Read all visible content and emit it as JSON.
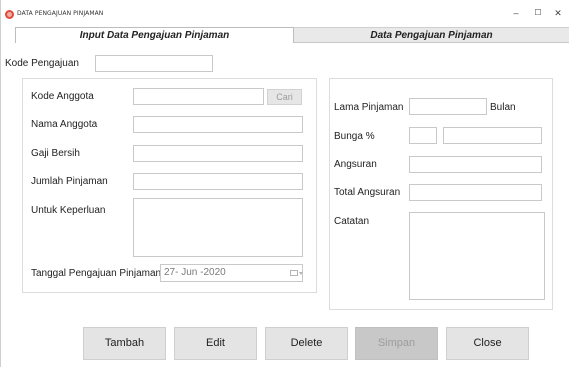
{
  "window": {
    "title": "DATA PENGAJUAN PINJAMAN",
    "minimize": "–",
    "maximize": "☐",
    "close": "✕"
  },
  "tabs": [
    {
      "label": "Input Data Pengajuan Pinjaman",
      "active": true
    },
    {
      "label": "Data Pengajuan Pinjaman",
      "active": false
    }
  ],
  "form": {
    "kode_pengajuan": {
      "label": "Kode Pengajuan",
      "value": ""
    },
    "kode_anggota": {
      "label": "Kode Anggota",
      "value": ""
    },
    "cari_button": "Cari",
    "nama_anggota": {
      "label": "Nama Anggota",
      "value": ""
    },
    "gaji_bersih": {
      "label": "Gaji Bersih",
      "value": ""
    },
    "jumlah_pinjaman": {
      "label": "Jumlah Pinjaman",
      "value": ""
    },
    "untuk_keperluan": {
      "label": "Untuk Keperluan",
      "value": ""
    },
    "tanggal_pengajuan": {
      "label": "Tanggal Pengajuan Pinjaman",
      "value": "27- Jun -2020"
    },
    "lama_pinjaman": {
      "label": "Lama Pinjaman",
      "value": "",
      "unit": "Bulan"
    },
    "bunga": {
      "label": "Bunga %",
      "value": "",
      "value2": ""
    },
    "angsuran": {
      "label": "Angsuran",
      "value": ""
    },
    "total_angsuran": {
      "label": "Total Angsuran",
      "value": ""
    },
    "catatan": {
      "label": "Catatan",
      "value": ""
    }
  },
  "buttons": {
    "tambah": "Tambah",
    "edit": "Edit",
    "delete": "Delete",
    "simpan": "Simpan",
    "close": "Close"
  },
  "colors": {
    "app_icon": "#e04b3a",
    "disabled_button": "#c8c8c8"
  }
}
